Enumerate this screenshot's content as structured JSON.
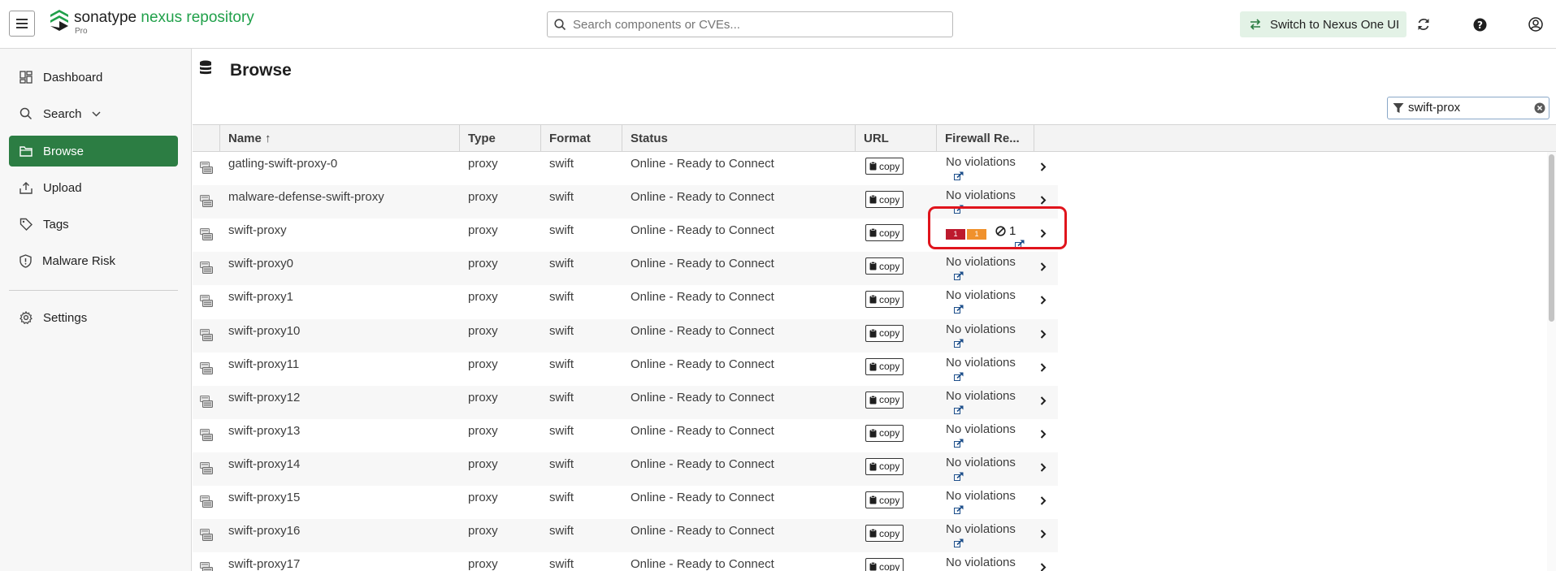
{
  "header": {
    "brand_primary": "sonatype",
    "brand_secondary": "nexus repository",
    "edition": "Pro",
    "search_placeholder": "Search components or CVEs...",
    "switch_label": "Switch to Nexus One UI"
  },
  "sidebar": {
    "items": [
      {
        "label": "Dashboard",
        "icon": "dashboard-icon"
      },
      {
        "label": "Search",
        "icon": "search-icon",
        "expandable": true
      },
      {
        "label": "Browse",
        "icon": "folder-icon",
        "active": true
      },
      {
        "label": "Upload",
        "icon": "upload-icon"
      },
      {
        "label": "Tags",
        "icon": "tag-icon"
      },
      {
        "label": "Malware Risk",
        "icon": "shield-icon"
      },
      {
        "label": "Settings",
        "icon": "gear-icon"
      }
    ]
  },
  "page": {
    "title": "Browse",
    "filter_value": "swift-prox"
  },
  "table": {
    "columns": [
      "Name ↑",
      "Type",
      "Format",
      "Status",
      "URL",
      "Firewall Re..."
    ],
    "copy_label": "copy",
    "rows": [
      {
        "name": "gatling-swift-proxy-0",
        "type": "proxy",
        "format": "swift",
        "status": "Online - Ready to Connect",
        "firewall": "No violations"
      },
      {
        "name": "malware-defense-swift-proxy",
        "type": "proxy",
        "format": "swift",
        "status": "Online - Ready to Connect",
        "firewall": "No violations"
      },
      {
        "name": "swift-proxy",
        "type": "proxy",
        "format": "swift",
        "status": "Online - Ready to Connect",
        "firewall": "",
        "critical": "1",
        "severe": "1",
        "waived": "1"
      },
      {
        "name": "swift-proxy0",
        "type": "proxy",
        "format": "swift",
        "status": "Online - Ready to Connect",
        "firewall": "No violations"
      },
      {
        "name": "swift-proxy1",
        "type": "proxy",
        "format": "swift",
        "status": "Online - Ready to Connect",
        "firewall": "No violations"
      },
      {
        "name": "swift-proxy10",
        "type": "proxy",
        "format": "swift",
        "status": "Online - Ready to Connect",
        "firewall": "No violations"
      },
      {
        "name": "swift-proxy11",
        "type": "proxy",
        "format": "swift",
        "status": "Online - Ready to Connect",
        "firewall": "No violations"
      },
      {
        "name": "swift-proxy12",
        "type": "proxy",
        "format": "swift",
        "status": "Online - Ready to Connect",
        "firewall": "No violations"
      },
      {
        "name": "swift-proxy13",
        "type": "proxy",
        "format": "swift",
        "status": "Online - Ready to Connect",
        "firewall": "No violations"
      },
      {
        "name": "swift-proxy14",
        "type": "proxy",
        "format": "swift",
        "status": "Online - Ready to Connect",
        "firewall": "No violations"
      },
      {
        "name": "swift-proxy15",
        "type": "proxy",
        "format": "swift",
        "status": "Online - Ready to Connect",
        "firewall": "No violations"
      },
      {
        "name": "swift-proxy16",
        "type": "proxy",
        "format": "swift",
        "status": "Online - Ready to Connect",
        "firewall": "No violations"
      },
      {
        "name": "swift-proxy17",
        "type": "proxy",
        "format": "swift",
        "status": "Online - Ready to Connect",
        "firewall": "No violations"
      }
    ]
  },
  "colors": {
    "accent_green": "#2c7d43",
    "brand_green": "#20a04a",
    "critical_red": "#bd1a2e",
    "severe_orange": "#f0912c",
    "highlight_red": "#e0141c"
  }
}
